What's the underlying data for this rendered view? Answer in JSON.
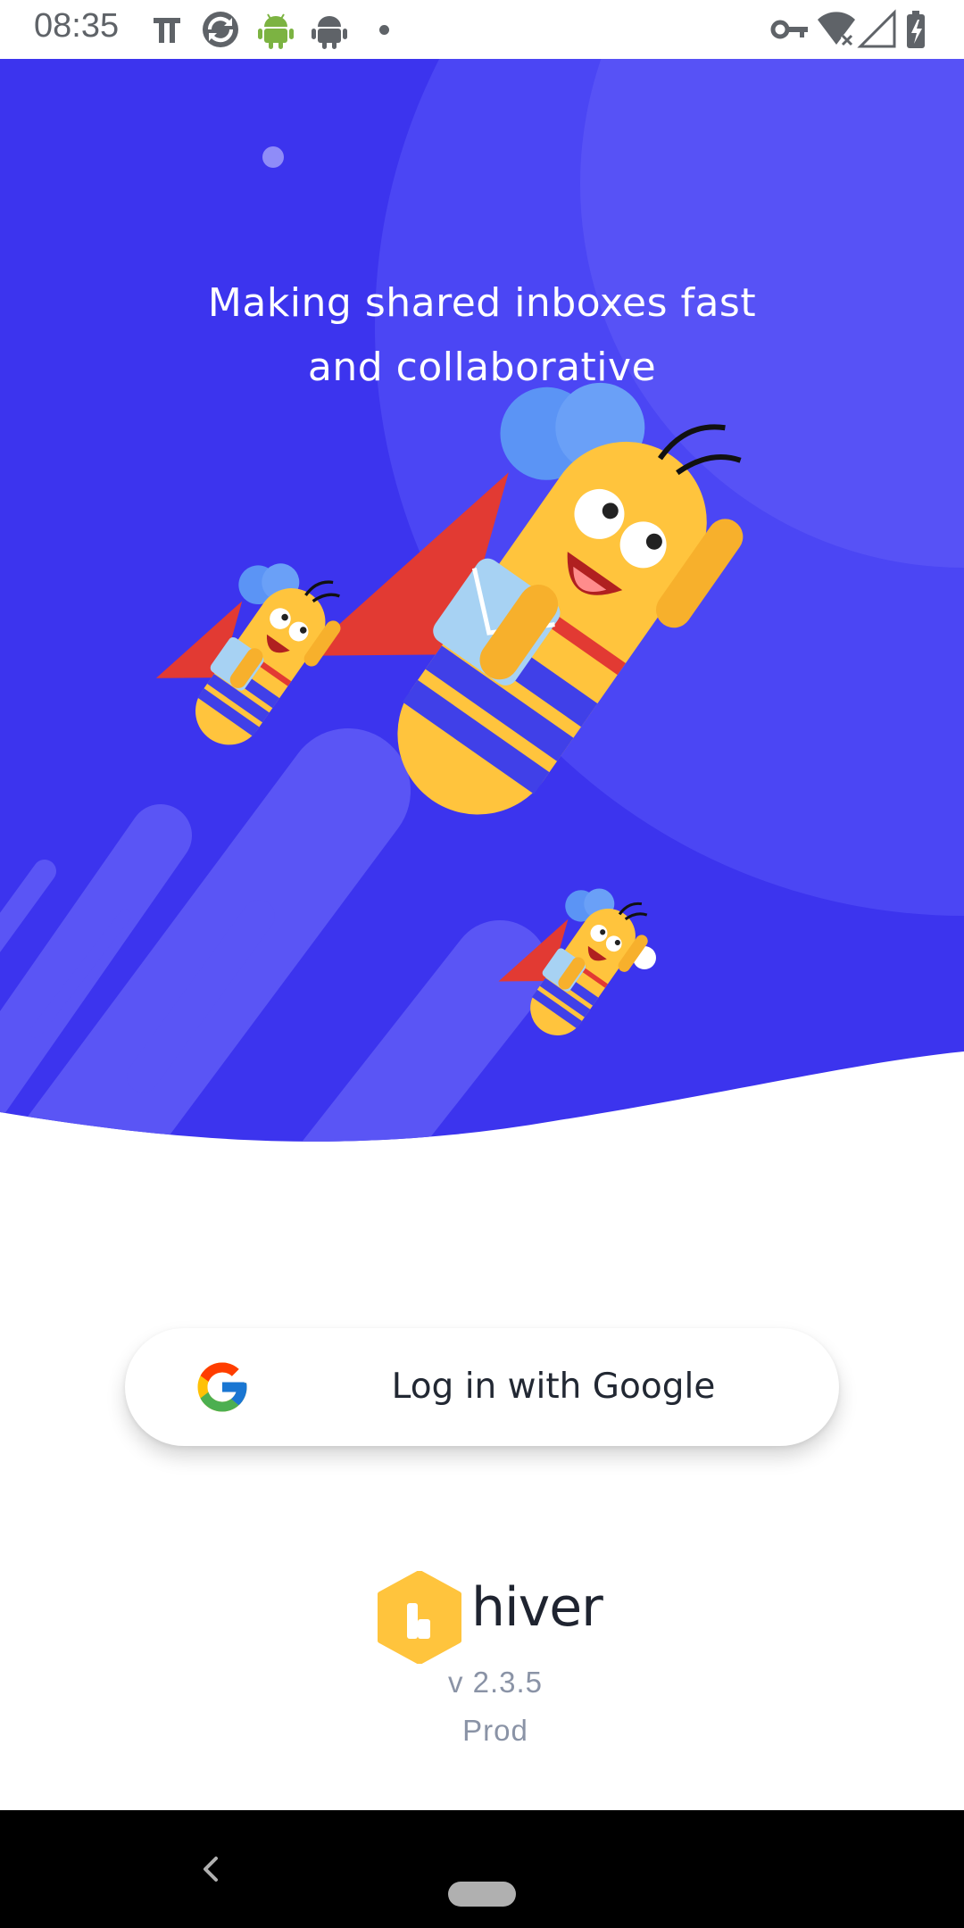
{
  "status_bar": {
    "time": "08:35",
    "left_icons": [
      "notification-icon",
      "sync-icon",
      "android-debug-icon",
      "android-icon",
      "more-dot-icon"
    ],
    "right_icons": [
      "vpn-key-icon",
      "wifi-off-icon",
      "cellular-signal-icon",
      "battery-charging-icon"
    ]
  },
  "hero": {
    "tagline_line1": "Making shared inboxes fast",
    "tagline_line2": "and collaborative",
    "illustration": "flying-bee-mascots-illustration",
    "colors": {
      "background": "#3c34ee",
      "accent": "#ffc43d",
      "wing": "#5b94f5",
      "cape": "#e23a33"
    }
  },
  "login": {
    "google_button_label": "Log in with Google",
    "icon": "google-g-icon"
  },
  "brand": {
    "name": "hiver",
    "logo": "hiver-logo-icon",
    "version": "v 2.3.5",
    "environment": "Prod",
    "color": "#ffc43d"
  },
  "nav_bar": {
    "icons": [
      "back-icon",
      "home-pill-icon"
    ]
  }
}
